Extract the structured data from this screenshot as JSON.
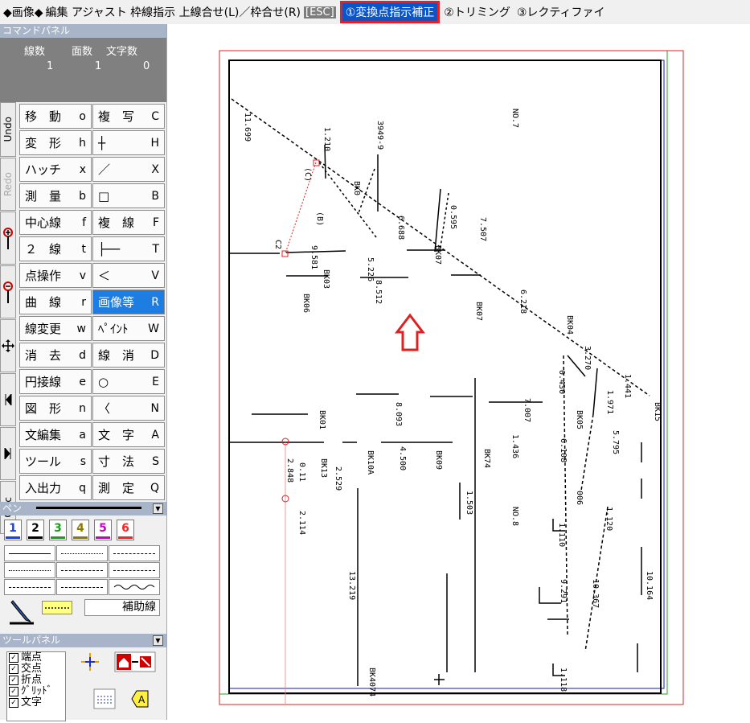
{
  "topbar": {
    "title": "◆画像◆",
    "mode": "編集 アジャスト 枠線指示 上線合せ(L)／枠合せ(R)",
    "esc": "[ESC]",
    "step1": "①変換点指示補正",
    "step2": "②トリミング",
    "step3": "③レクティファイ"
  },
  "command_panel": {
    "title": "コマンドパネル",
    "counter_labels": [
      "線数",
      "面数",
      "文字数"
    ],
    "counter_values": [
      "1",
      "1",
      "0"
    ]
  },
  "side_tabs": [
    "Undo",
    "Redo",
    "Calc"
  ],
  "commands": [
    {
      "label": "移　動",
      "key": "o"
    },
    {
      "label": "複　写",
      "key": "C"
    },
    {
      "label": "変　形",
      "key": "h"
    },
    {
      "label": "┼",
      "key": "H"
    },
    {
      "label": "ハッチ",
      "key": "x"
    },
    {
      "label": "／",
      "key": "X"
    },
    {
      "label": "測　量",
      "key": "b"
    },
    {
      "label": "□",
      "key": "B"
    },
    {
      "label": "中心線",
      "key": "f"
    },
    {
      "label": "複　線",
      "key": "F"
    },
    {
      "label": "２　線",
      "key": "t"
    },
    {
      "label": "├──",
      "key": "T"
    },
    {
      "label": "点操作",
      "key": "v"
    },
    {
      "label": "＜",
      "key": "V"
    },
    {
      "label": "曲　線",
      "key": "r"
    },
    {
      "label": "画像等",
      "key": "R"
    },
    {
      "label": "線変更",
      "key": "w"
    },
    {
      "label": "ﾍﾟｲﾝﾄ",
      "key": "W"
    },
    {
      "label": "消　去",
      "key": "d"
    },
    {
      "label": "線　消",
      "key": "D"
    },
    {
      "label": "円接線",
      "key": "e"
    },
    {
      "label": "○",
      "key": "E"
    },
    {
      "label": "図　形",
      "key": "n"
    },
    {
      "label": "〈",
      "key": "N"
    },
    {
      "label": "文編集",
      "key": "a"
    },
    {
      "label": "文　字",
      "key": "A"
    },
    {
      "label": "ツール",
      "key": "s"
    },
    {
      "label": "寸　法",
      "key": "S"
    },
    {
      "label": "入出力",
      "key": "q"
    },
    {
      "label": "測　定",
      "key": "Q"
    }
  ],
  "pen": {
    "title": "ペン",
    "colors": [
      {
        "num": "1",
        "color": "#1a3cff"
      },
      {
        "num": "2",
        "color": "#000000"
      },
      {
        "num": "3",
        "color": "#1aa01a"
      },
      {
        "num": "4",
        "color": "#8a7a00"
      },
      {
        "num": "5",
        "color": "#c800c8"
      },
      {
        "num": "6",
        "color": "#ff2020"
      }
    ],
    "aux_label": "補助線"
  },
  "tool_panel": {
    "title": "ツールパネル",
    "snaps": [
      "端点",
      "交点",
      "折点",
      "ｸﾞﾘｯﾄﾞ",
      "文字"
    ]
  },
  "drawing": {
    "labels": [
      "11.699",
      "1.210",
      "3949-9",
      "NO.7",
      "(B)",
      "(C)",
      "C2",
      "BK0",
      "6.688",
      "0.595",
      "BK07",
      "7.507",
      "9.581",
      "BK03",
      "5.226",
      "8.512",
      "BK06",
      "BK07",
      "6.218",
      "BK04",
      "3.270",
      "0.430",
      "1.971",
      "1.441",
      "BK15",
      "BK01",
      "8.093",
      "7.007",
      "BK05",
      "BK13",
      "1.436",
      "6.108",
      "5.795",
      "BK74",
      "2.529",
      "4.500",
      "BK09",
      "BK10A",
      "2.848",
      "0.11",
      "1.503",
      "NO.8",
      "006",
      "1.120",
      "2.114",
      "13.219",
      "9.291",
      "10.164",
      "10.367",
      "BK4074",
      "1.118",
      "1.110"
    ]
  },
  "accent": {
    "active_step": "#0a55c8",
    "highlight_border": "#e0202a",
    "active_cmd": "#1e7de0",
    "arrow": "#e0202a"
  }
}
